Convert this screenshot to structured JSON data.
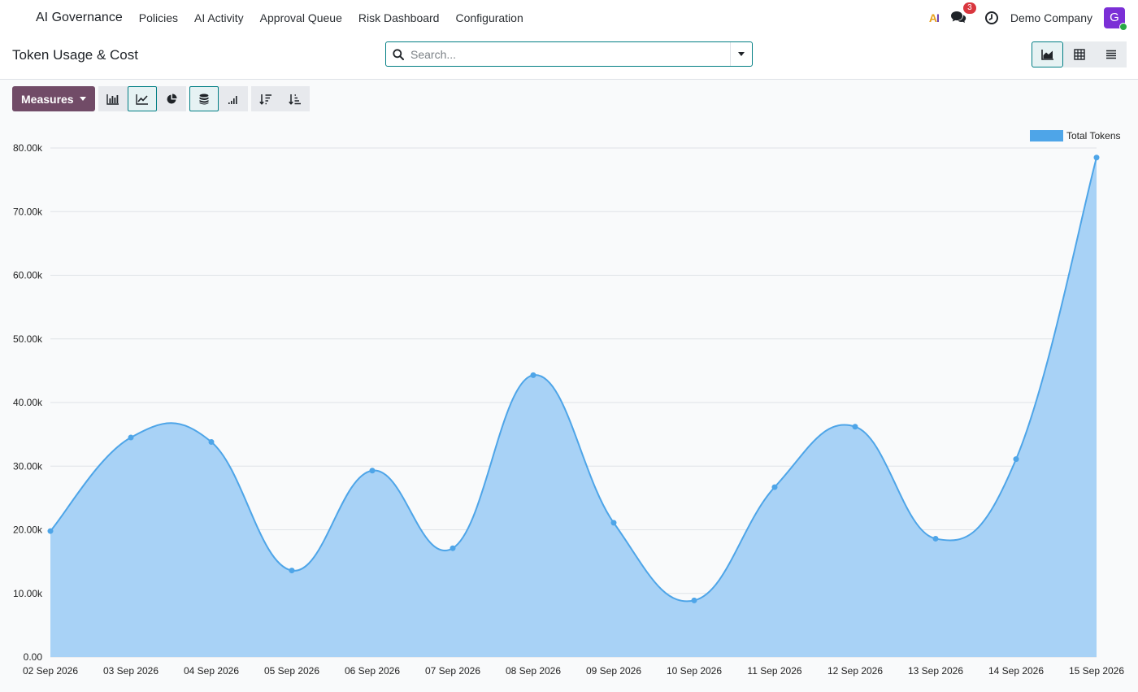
{
  "navbar": {
    "brand": "AI Governance",
    "menu": [
      "Policies",
      "AI Activity",
      "Approval Queue",
      "Risk Dashboard",
      "Configuration"
    ],
    "ai_badge": "AI",
    "messages_count": "3",
    "company": "Demo Company",
    "avatar_letter": "G"
  },
  "control": {
    "title": "Token Usage & Cost",
    "search_placeholder": "Search..."
  },
  "toolbar": {
    "measures_label": "Measures"
  },
  "colors": {
    "brand": "#714b67",
    "accent": "#017e84",
    "series": "#4ea5e8",
    "fill": "#a8d2f6"
  },
  "chart_data": {
    "type": "area",
    "x": [
      "02 Sep 2026",
      "03 Sep 2026",
      "04 Sep 2026",
      "05 Sep 2026",
      "06 Sep 2026",
      "07 Sep 2026",
      "08 Sep 2026",
      "09 Sep 2026",
      "10 Sep 2026",
      "11 Sep 2026",
      "12 Sep 2026",
      "13 Sep 2026",
      "14 Sep 2026",
      "15 Sep 2026"
    ],
    "series": [
      {
        "name": "Total Tokens",
        "values": [
          19800,
          34500,
          33800,
          13600,
          29300,
          17100,
          44300,
          21100,
          8900,
          26700,
          36200,
          18600,
          31100,
          78500
        ]
      }
    ],
    "ylim": [
      0,
      80000
    ],
    "yticks": [
      "0.00",
      "10.00k",
      "20.00k",
      "30.00k",
      "40.00k",
      "50.00k",
      "60.00k",
      "70.00k",
      "80.00k"
    ],
    "grid": true,
    "legend": "top-right"
  }
}
